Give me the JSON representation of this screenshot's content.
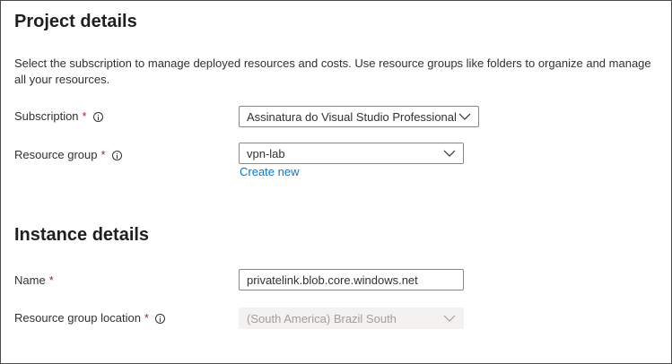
{
  "project": {
    "title": "Project details",
    "description": "Select the subscription to manage deployed resources and costs. Use resource groups like folders to organize and manage all your resources.",
    "subscription": {
      "label": "Subscription",
      "required_mark": "*",
      "value": "Assinatura do Visual Studio Professional"
    },
    "resource_group": {
      "label": "Resource group",
      "required_mark": "*",
      "value": "vpn-lab",
      "create_new": "Create new"
    }
  },
  "instance": {
    "title": "Instance details",
    "name": {
      "label": "Name",
      "required_mark": "*",
      "value": "privatelink.blob.core.windows.net"
    },
    "location": {
      "label": "Resource group location",
      "required_mark": "*",
      "value": "(South America) Brazil South"
    }
  },
  "icons": {
    "info": "info-icon",
    "dropdown": "chevron-down-icon"
  },
  "colors": {
    "required": "#a4262c",
    "link": "#0078d4",
    "disabled_bg": "#f3f2f1",
    "disabled_text": "#a19f9d"
  }
}
